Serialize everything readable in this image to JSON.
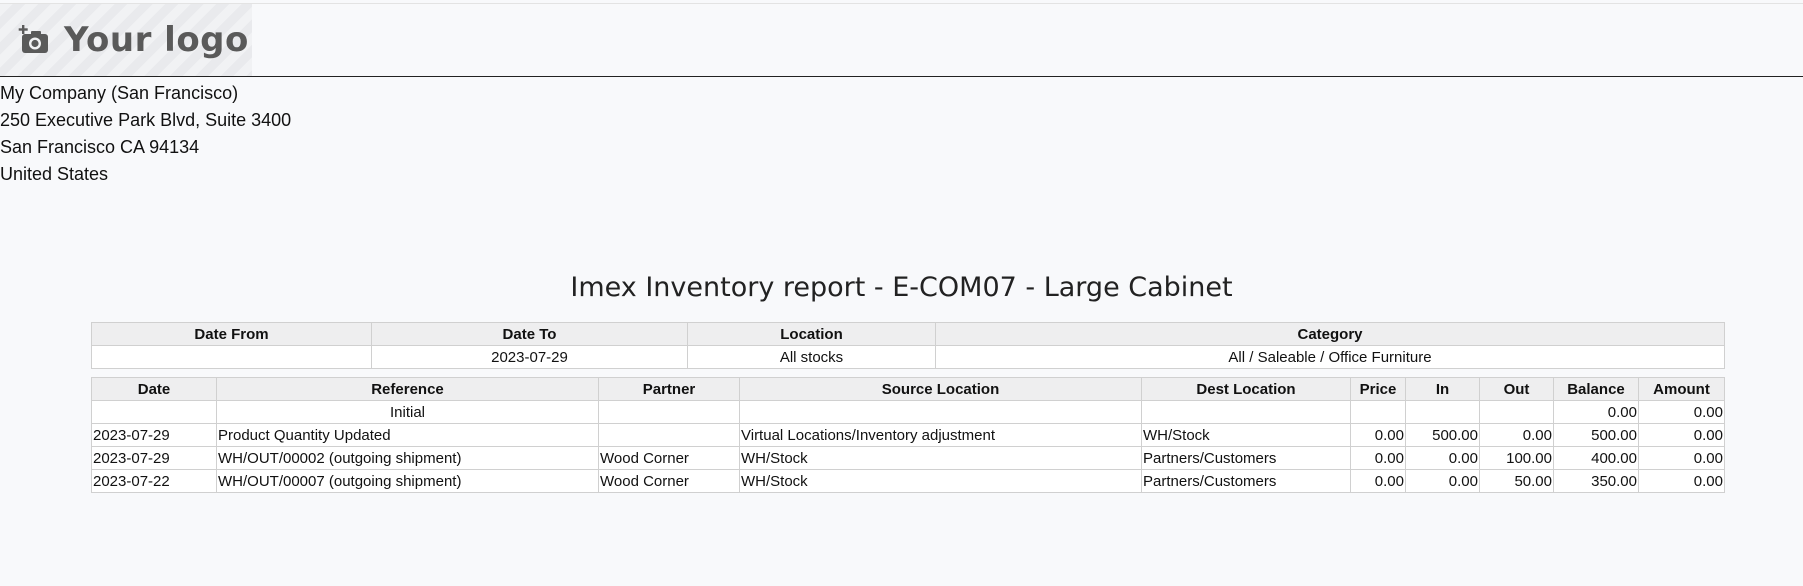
{
  "company": {
    "logo_text": "Your logo",
    "logo_icon": "camera-plus-icon",
    "address_lines": [
      "My Company (San Francisco)",
      "250 Executive Park Blvd, Suite 3400",
      "San Francisco CA 94134",
      "United States"
    ]
  },
  "report": {
    "title": "Imex Inventory report - E-COM07 - Large Cabinet"
  },
  "filters": {
    "headers": [
      "Date From",
      "Date To",
      "Location",
      "Category"
    ],
    "values": [
      "",
      "2023-07-29",
      "All stocks",
      "All / Saleable / Office Furniture"
    ]
  },
  "moves": {
    "headers": [
      "Date",
      "Reference",
      "Partner",
      "Source Location",
      "Dest Location",
      "Price",
      "In",
      "Out",
      "Balance",
      "Amount"
    ],
    "initial": {
      "label": "Initial",
      "balance": "0.00",
      "amount": "0.00"
    },
    "rows": [
      {
        "date": "2023-07-29",
        "reference": "Product Quantity Updated",
        "partner": "",
        "source": "Virtual Locations/Inventory adjustment",
        "dest": "WH/Stock",
        "price": "0.00",
        "in": "500.00",
        "out": "0.00",
        "balance": "500.00",
        "amount": "0.00"
      },
      {
        "date": "2023-07-29",
        "reference": "WH/OUT/00002 (outgoing shipment)",
        "partner": "Wood Corner",
        "source": "WH/Stock",
        "dest": "Partners/Customers",
        "price": "0.00",
        "in": "0.00",
        "out": "100.00",
        "balance": "400.00",
        "amount": "0.00"
      },
      {
        "date": "2023-07-22",
        "reference": "WH/OUT/00007 (outgoing shipment)",
        "partner": "Wood Corner",
        "source": "WH/Stock",
        "dest": "Partners/Customers",
        "price": "0.00",
        "in": "0.00",
        "out": "50.00",
        "balance": "350.00",
        "amount": "0.00"
      }
    ]
  }
}
